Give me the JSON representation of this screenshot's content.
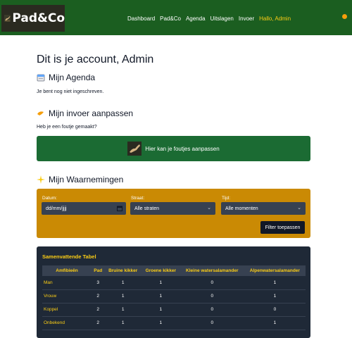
{
  "header": {
    "logo_text": "Pad&Co",
    "nav": [
      "Dashboard",
      "Pad&Co",
      "Agenda",
      "Uitslagen",
      "Invoer"
    ],
    "greeting": "Hallo, Admin"
  },
  "page_title": "Dit is je account, Admin",
  "agenda": {
    "title": "Mijn Agenda",
    "text": "Je bent nog niet ingeschreven."
  },
  "invoer": {
    "title": "Mijn invoer aanpassen",
    "text": "Heb je een foutje gemaakt?",
    "button": "Hier kan je foutjes aanpassen"
  },
  "waarnemingen": {
    "title": "Mijn Waarnemingen",
    "filters": {
      "datum_label": "Datum:",
      "datum_value": "dd/mm/jjjj",
      "straat_label": "Straat:",
      "straat_value": "Alle straten",
      "tijd_label": "Tijd:",
      "tijd_value": "Alle momenten",
      "button": "Filter toepassen"
    }
  },
  "table": {
    "title": "Samenvattende Tabel",
    "headers": [
      "Amfibieën",
      "Pad",
      "Bruine kikker",
      "Groene kikker",
      "Kleine watersalamander",
      "Alpenwatersalamander"
    ],
    "rows": [
      [
        "Man",
        "3",
        "1",
        "1",
        "0",
        "1"
      ],
      [
        "Vrouw",
        "2",
        "1",
        "1",
        "0",
        "1"
      ],
      [
        "Koppel",
        "2",
        "1",
        "1",
        "0",
        "0"
      ],
      [
        "Onbekend",
        "2",
        "1",
        "1",
        "0",
        "1"
      ]
    ]
  },
  "colors": {
    "header_green": "#1b5e20",
    "accent_yellow": "#facc15",
    "filter_bg": "#ca8a04",
    "table_bg": "#1f2937"
  }
}
